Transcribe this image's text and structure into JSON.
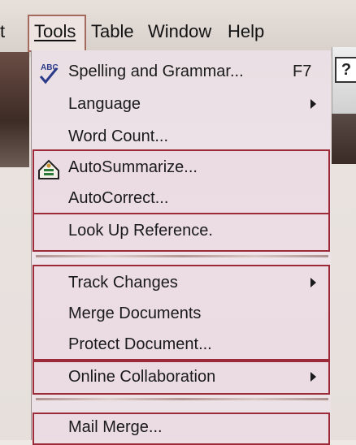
{
  "menubar": {
    "edge_text": "t",
    "items": [
      {
        "label": "Tools",
        "mnemonic_index": 0
      },
      {
        "label": "Table",
        "mnemonic_index": 1
      },
      {
        "label": "Window",
        "mnemonic_index": 0
      },
      {
        "label": "Help",
        "mnemonic_index": 0
      }
    ]
  },
  "help_button": {
    "label": "?"
  },
  "menu": {
    "items": [
      {
        "label": "Spelling and Grammar...",
        "shortcut": "F7",
        "icon": "spelling-icon"
      },
      {
        "label": "Language",
        "submenu": true
      },
      {
        "label": "Word Count..."
      },
      {
        "label": "AutoSummarize...",
        "icon": "autosummarize-icon"
      },
      {
        "label": "AutoCorrect..."
      },
      {
        "label": "Look Up Reference."
      },
      {
        "label": "Track Changes",
        "submenu": true
      },
      {
        "label": "Merge Documents"
      },
      {
        "label": "Protect Document..."
      },
      {
        "label": "Online Collaboration",
        "submenu": true
      },
      {
        "label": "Mail Merge..."
      }
    ]
  },
  "colors": {
    "group_outline": "#9c2a39",
    "menu_background": "#eadfe4",
    "text": "#1a1a1a"
  }
}
